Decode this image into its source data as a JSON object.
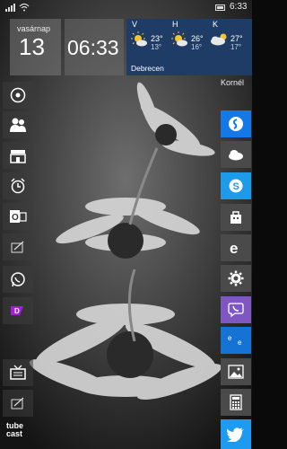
{
  "status": {
    "time": "6:33"
  },
  "date_tile": {
    "day_name": "vasárnap",
    "day_num": "13"
  },
  "clock_tile": {
    "time": "06:33"
  },
  "weather": {
    "city": "Debrecen",
    "days": [
      {
        "label": "V",
        "high": "23°",
        "low": "13°",
        "icon": "sun-cloud-icon"
      },
      {
        "label": "H",
        "high": "26°",
        "low": "16°",
        "icon": "sun-cloud-icon"
      },
      {
        "label": "K",
        "high": "27°",
        "low": "17°",
        "icon": "cloud-sun-icon"
      }
    ]
  },
  "right_header": "Kornél",
  "left_tiles": [
    {
      "name": "groove-music-tile",
      "icon": "music-disc-icon"
    },
    {
      "name": "people-tile",
      "icon": "people-icon"
    },
    {
      "name": "store-tile",
      "icon": "store-icon"
    },
    {
      "name": "alarms-tile",
      "icon": "alarm-clock-icon"
    },
    {
      "name": "outlook-tile",
      "icon": "outlook-icon"
    },
    {
      "name": "app-tile",
      "icon": "pen-paper-icon"
    },
    {
      "name": "whatsapp-tile",
      "icon": "whatsapp-icon"
    },
    {
      "name": "app-purple-tile",
      "icon": "purple-app-icon"
    },
    {
      "name": "tv-tile",
      "icon": "tv-icon"
    },
    {
      "name": "app-tile-2",
      "icon": "pen-paper-icon"
    }
  ],
  "right_tiles": [
    {
      "name": "shazam-tile",
      "icon": "shazam-icon",
      "color": "#1478e6"
    },
    {
      "name": "onedrive-tile",
      "icon": "cloud-icon",
      "color": "#4a4a4a"
    },
    {
      "name": "skype-tile",
      "icon": "skype-icon",
      "color": "#1e9be8"
    },
    {
      "name": "store-tile-right",
      "icon": "store-icon",
      "color": "#4a4a4a"
    },
    {
      "name": "edge-tile",
      "icon": "edge-icon",
      "color": "#4a4a4a"
    },
    {
      "name": "settings-tile",
      "icon": "gear-icon",
      "color": "#4a4a4a"
    },
    {
      "name": "viber-tile",
      "icon": "viber-icon",
      "color": "#7e57c2"
    },
    {
      "name": "edge-blue-tile",
      "icon": "edge-double-icon",
      "color": "#1573d6"
    },
    {
      "name": "photos-tile",
      "icon": "photos-icon",
      "color": "#4a4a4a"
    },
    {
      "name": "calculator-tile",
      "icon": "calculator-icon",
      "color": "#4a4a4a"
    },
    {
      "name": "twitter-tile",
      "icon": "twitter-icon",
      "color": "#1d9bf0"
    }
  ],
  "tubecast": {
    "line1": "tube",
    "line2": "cast"
  }
}
